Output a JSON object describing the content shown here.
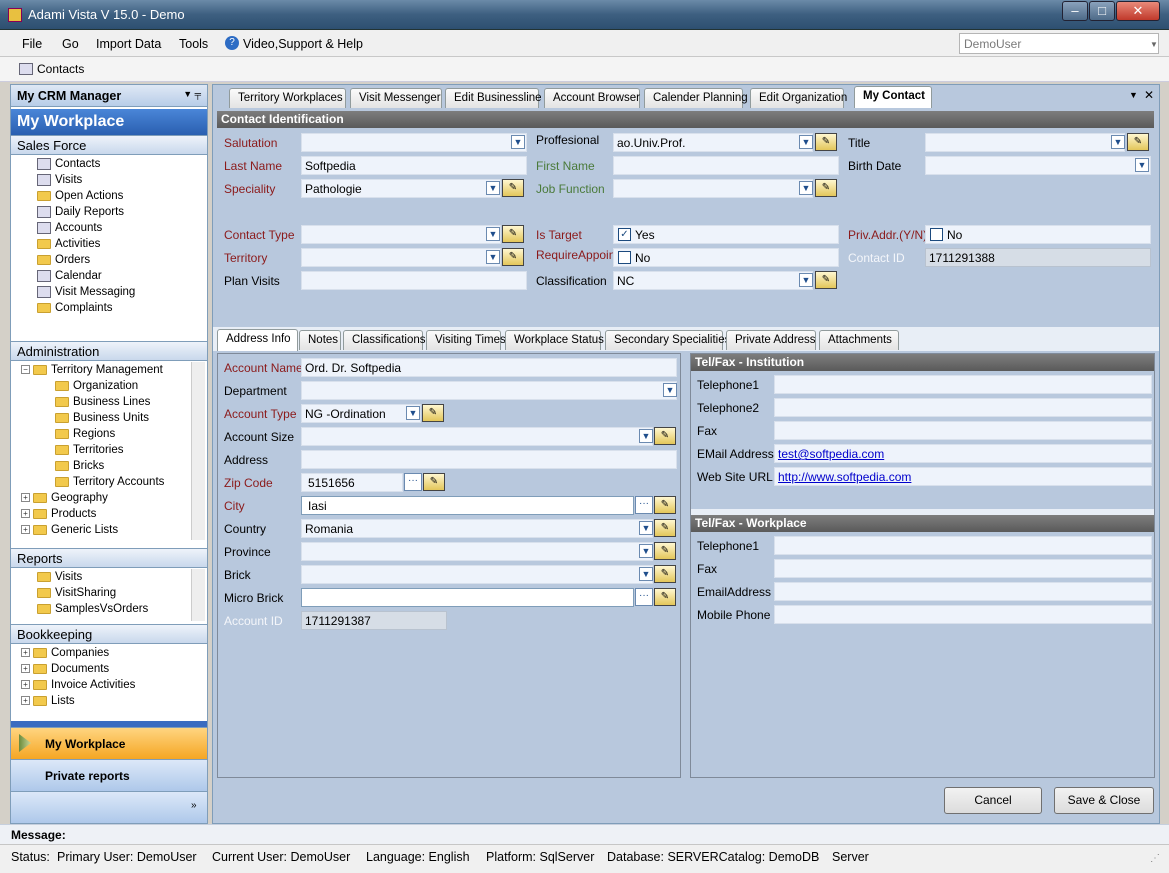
{
  "window": {
    "title": "Adami Vista V 15.0 - Demo",
    "min": "–",
    "max": "□",
    "close": "✕"
  },
  "menu": {
    "file": "File",
    "go": "Go",
    "import": "Import Data",
    "tools": "Tools",
    "help": "Video,Support & Help",
    "user": "DemoUser"
  },
  "toolbar": {
    "contacts": "Contacts"
  },
  "left": {
    "title": "My CRM Manager",
    "workplace": "My Workplace",
    "sales_force": "Sales Force",
    "sales_items": [
      "Contacts",
      "Visits",
      "Open Actions",
      "Daily Reports",
      "Accounts",
      "Activities",
      "Orders",
      "Calendar",
      "Visit Messaging",
      "Complaints"
    ],
    "administration": "Administration",
    "admin_items": [
      "Territory Management",
      "Organization",
      "Business Lines",
      "Business Units",
      "Regions",
      "Territories",
      "Bricks",
      "Territory Accounts",
      "Geography",
      "Products",
      "Generic Lists"
    ],
    "reports": "Reports",
    "report_items": [
      "Visits",
      "VisitSharing",
      "SamplesVsOrders"
    ],
    "bookkeeping": "Bookkeeping",
    "book_items": [
      "Companies",
      "Documents",
      "Invoice Activities",
      "Lists"
    ],
    "nav_workplace": "My Workplace",
    "nav_private": "Private reports"
  },
  "tabs": [
    "Territory Workplaces",
    "Visit Messenger",
    "Edit Businessline",
    "Account Browser",
    "Calender Planning",
    "Edit Organization",
    "My Contact"
  ],
  "contact": {
    "header": "Contact Identification",
    "salutation": "Salutation",
    "last_name_label": "Last Name",
    "last_name": "Softpedia",
    "speciality_label": "Speciality",
    "speciality": "Pathologie",
    "contact_type": "Contact Type",
    "territory": "Territory",
    "plan_visits": "Plan Visits",
    "proffesional_label": "Proffesional",
    "proffesional": "ao.Univ.Prof.",
    "first_name": "First Name",
    "job_function": "Job Function",
    "is_target_label": "Is Target",
    "is_target": "Yes",
    "require_label": "RequireAppoint",
    "require": "No",
    "classification_label": "Classification",
    "classification": "NC",
    "title": "Title",
    "birth_date": "Birth Date",
    "priv_label": "Priv.Addr.(Y/N)",
    "priv": "No",
    "contact_id_label": "Contact ID",
    "contact_id": "1711291388"
  },
  "subtabs": [
    "Address Info",
    "Notes",
    "Classifications",
    "Visiting Times",
    "Workplace Status",
    "Secondary Specialities",
    "Private Address",
    "Attachments"
  ],
  "address": {
    "account_name_label": "Account Name",
    "account_name": "Ord. Dr. Softpedia",
    "department": "Department",
    "account_type_label": "Account Type",
    "account_type": "NG -Ordination",
    "account_size": "Account Size",
    "address": "Address",
    "zip_label": "Zip Code",
    "zip": "5151656",
    "city_label": "City",
    "city": "Iasi",
    "country_label": "Country",
    "country": "Romania",
    "province": "Province",
    "brick": "Brick",
    "micro_brick": "Micro Brick",
    "account_id_label": "Account ID",
    "account_id": "1711291387"
  },
  "institution": {
    "header": "Tel/Fax - Institution",
    "telephone1": "Telephone1",
    "telephone2": "Telephone2",
    "fax": "Fax",
    "email_label": "EMail Address",
    "email": "test@softpedia.com",
    "web_label": "Web Site URL",
    "web": "http://www.softpedia.com"
  },
  "workplace": {
    "header": "Tel/Fax - Workplace",
    "telephone1": "Telephone1",
    "fax": "Fax",
    "email": "EmailAddress",
    "mobile": "Mobile Phone"
  },
  "buttons": {
    "cancel": "Cancel",
    "save_close": "Save & Close"
  },
  "message_label": "Message:",
  "status": {
    "status": "Status:",
    "primary": "Primary User: DemoUser",
    "current": "Current User: DemoUser",
    "language": "Language: English",
    "platform": "Platform: SqlServer",
    "database": "Database: SERVERCatalog: DemoDB",
    "server": "Server"
  }
}
